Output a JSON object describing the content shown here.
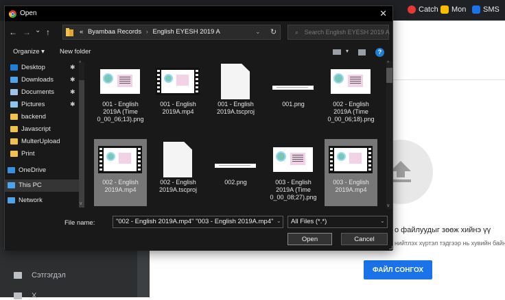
{
  "browser": {
    "bookmarks": [
      {
        "label": "Catch",
        "color": "#e53935"
      },
      {
        "label": "Mon",
        "color": "#fbbc04"
      },
      {
        "label": "SMS",
        "color": "#1a73e8"
      }
    ]
  },
  "background_page": {
    "sidebar_items": [
      {
        "label": "Сэтгэгдэл",
        "icon": "comment-icon"
      },
      {
        "label": "Х",
        "icon": "list-icon"
      }
    ],
    "upload_title": "о файлуудыг зөөж хийнэ үү",
    "upload_subtitle": "нийтлэх хүртэл тэдгээр нь хувийн байна.",
    "upload_button": "ФАЙЛ СОНГОХ"
  },
  "dialog": {
    "title": "Open",
    "close_glyph": "✕",
    "nav": {
      "back": "←",
      "forward": "→",
      "recent": "⌄",
      "up": "↑"
    },
    "breadcrumbs": [
      "«",
      "Byambaa Records",
      "English EYESH 2019 A"
    ],
    "search_placeholder": "Search English EYESH 2019 A",
    "toolbar": {
      "organize": "Organize ▾",
      "new_folder": "New folder",
      "help": "?"
    },
    "nav_pane": [
      {
        "label": "Desktop",
        "icon": "desktop-icon",
        "color": "#1e7fd9",
        "pinned": true,
        "selected": false
      },
      {
        "label": "Downloads",
        "icon": "download-icon",
        "color": "#4fa3e8",
        "pinned": true,
        "selected": false
      },
      {
        "label": "Documents",
        "icon": "documents-icon",
        "color": "#9ec3e6",
        "pinned": true,
        "selected": false
      },
      {
        "label": "Pictures",
        "icon": "pictures-icon",
        "color": "#8ac6f0",
        "pinned": true,
        "selected": false
      },
      {
        "label": "backend",
        "icon": "folder-icon",
        "color": "#f3c14b",
        "pinned": false,
        "selected": false
      },
      {
        "label": "Javascript",
        "icon": "folder-icon",
        "color": "#f3c14b",
        "pinned": false,
        "selected": false
      },
      {
        "label": "MulterUpload",
        "icon": "folder-icon",
        "color": "#f3c14b",
        "pinned": false,
        "selected": false
      },
      {
        "label": "Print",
        "icon": "folder-icon",
        "color": "#f3c14b",
        "pinned": false,
        "selected": false
      },
      {
        "label": "OneDrive",
        "icon": "onedrive-icon",
        "color": "#3b8fe0",
        "pinned": false,
        "selected": false
      },
      {
        "label": "This PC",
        "icon": "pc-icon",
        "color": "#4fa3e8",
        "pinned": false,
        "selected": true
      },
      {
        "label": "Network",
        "icon": "network-icon",
        "color": "#4fa3e8",
        "pinned": false,
        "selected": false
      }
    ],
    "pin_glyph": "📌",
    "files": [
      {
        "name": "001 - English 2019A (Time 0_00_06;13).png",
        "kind": "image",
        "selected": false
      },
      {
        "name": "001 - English 2019A.mp4",
        "kind": "video",
        "selected": false
      },
      {
        "name": "001 - English 2019A.tscproj",
        "kind": "doc",
        "selected": false
      },
      {
        "name": "001.png",
        "kind": "strip",
        "selected": false
      },
      {
        "name": "002 - English 2019A (Time 0_00_06;18).png",
        "kind": "image",
        "selected": false
      },
      {
        "name": "002 - English 2019A.mp4",
        "kind": "video",
        "selected": true
      },
      {
        "name": "002 - English 2019A.tscproj",
        "kind": "doc",
        "selected": false
      },
      {
        "name": "002.png",
        "kind": "strip",
        "selected": false
      },
      {
        "name": "003 - English 2019A (Time 0_00_08;27).png",
        "kind": "image",
        "selected": false
      },
      {
        "name": "003 - English 2019A.mp4",
        "kind": "video",
        "selected": true
      }
    ],
    "file_name_label": "File name:",
    "file_name_value": "\"002 - English 2019A.mp4\" \"003 - English 2019A.mp4\"",
    "file_type": "All Files (*.*)",
    "open_button": "Open",
    "cancel_button": "Cancel"
  }
}
